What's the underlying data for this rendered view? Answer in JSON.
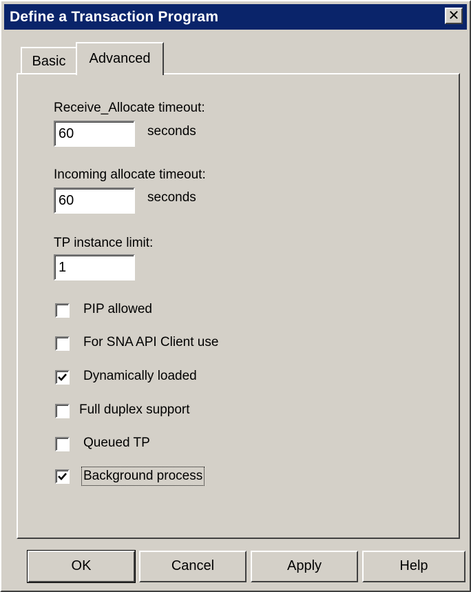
{
  "window": {
    "title": "Define a Transaction Program",
    "close_glyph": "✕"
  },
  "tabs": [
    {
      "label": "Basic",
      "active": false
    },
    {
      "label": "Advanced",
      "active": true
    }
  ],
  "fields": {
    "receive_allocate_timeout": {
      "label": "Receive_Allocate timeout:",
      "value": "60",
      "unit": "seconds"
    },
    "incoming_allocate_timeout": {
      "label": "Incoming allocate timeout:",
      "value": "60",
      "unit": "seconds"
    },
    "tp_instance_limit": {
      "label": "TP instance limit:",
      "value": "1"
    }
  },
  "checkboxes": [
    {
      "label": "PIP allowed",
      "checked": false
    },
    {
      "label": "For SNA API Client use",
      "checked": false
    },
    {
      "label": "Dynamically loaded",
      "checked": true
    },
    {
      "label": "Full duplex support",
      "checked": false
    },
    {
      "label": "Queued TP",
      "checked": false
    },
    {
      "label": "Background process",
      "checked": true,
      "focused": true
    }
  ],
  "buttons": {
    "ok": "OK",
    "cancel": "Cancel",
    "apply": "Apply",
    "help": "Help"
  },
  "colors": {
    "titlebar": "#0a246a",
    "face": "#d4d0c8"
  }
}
